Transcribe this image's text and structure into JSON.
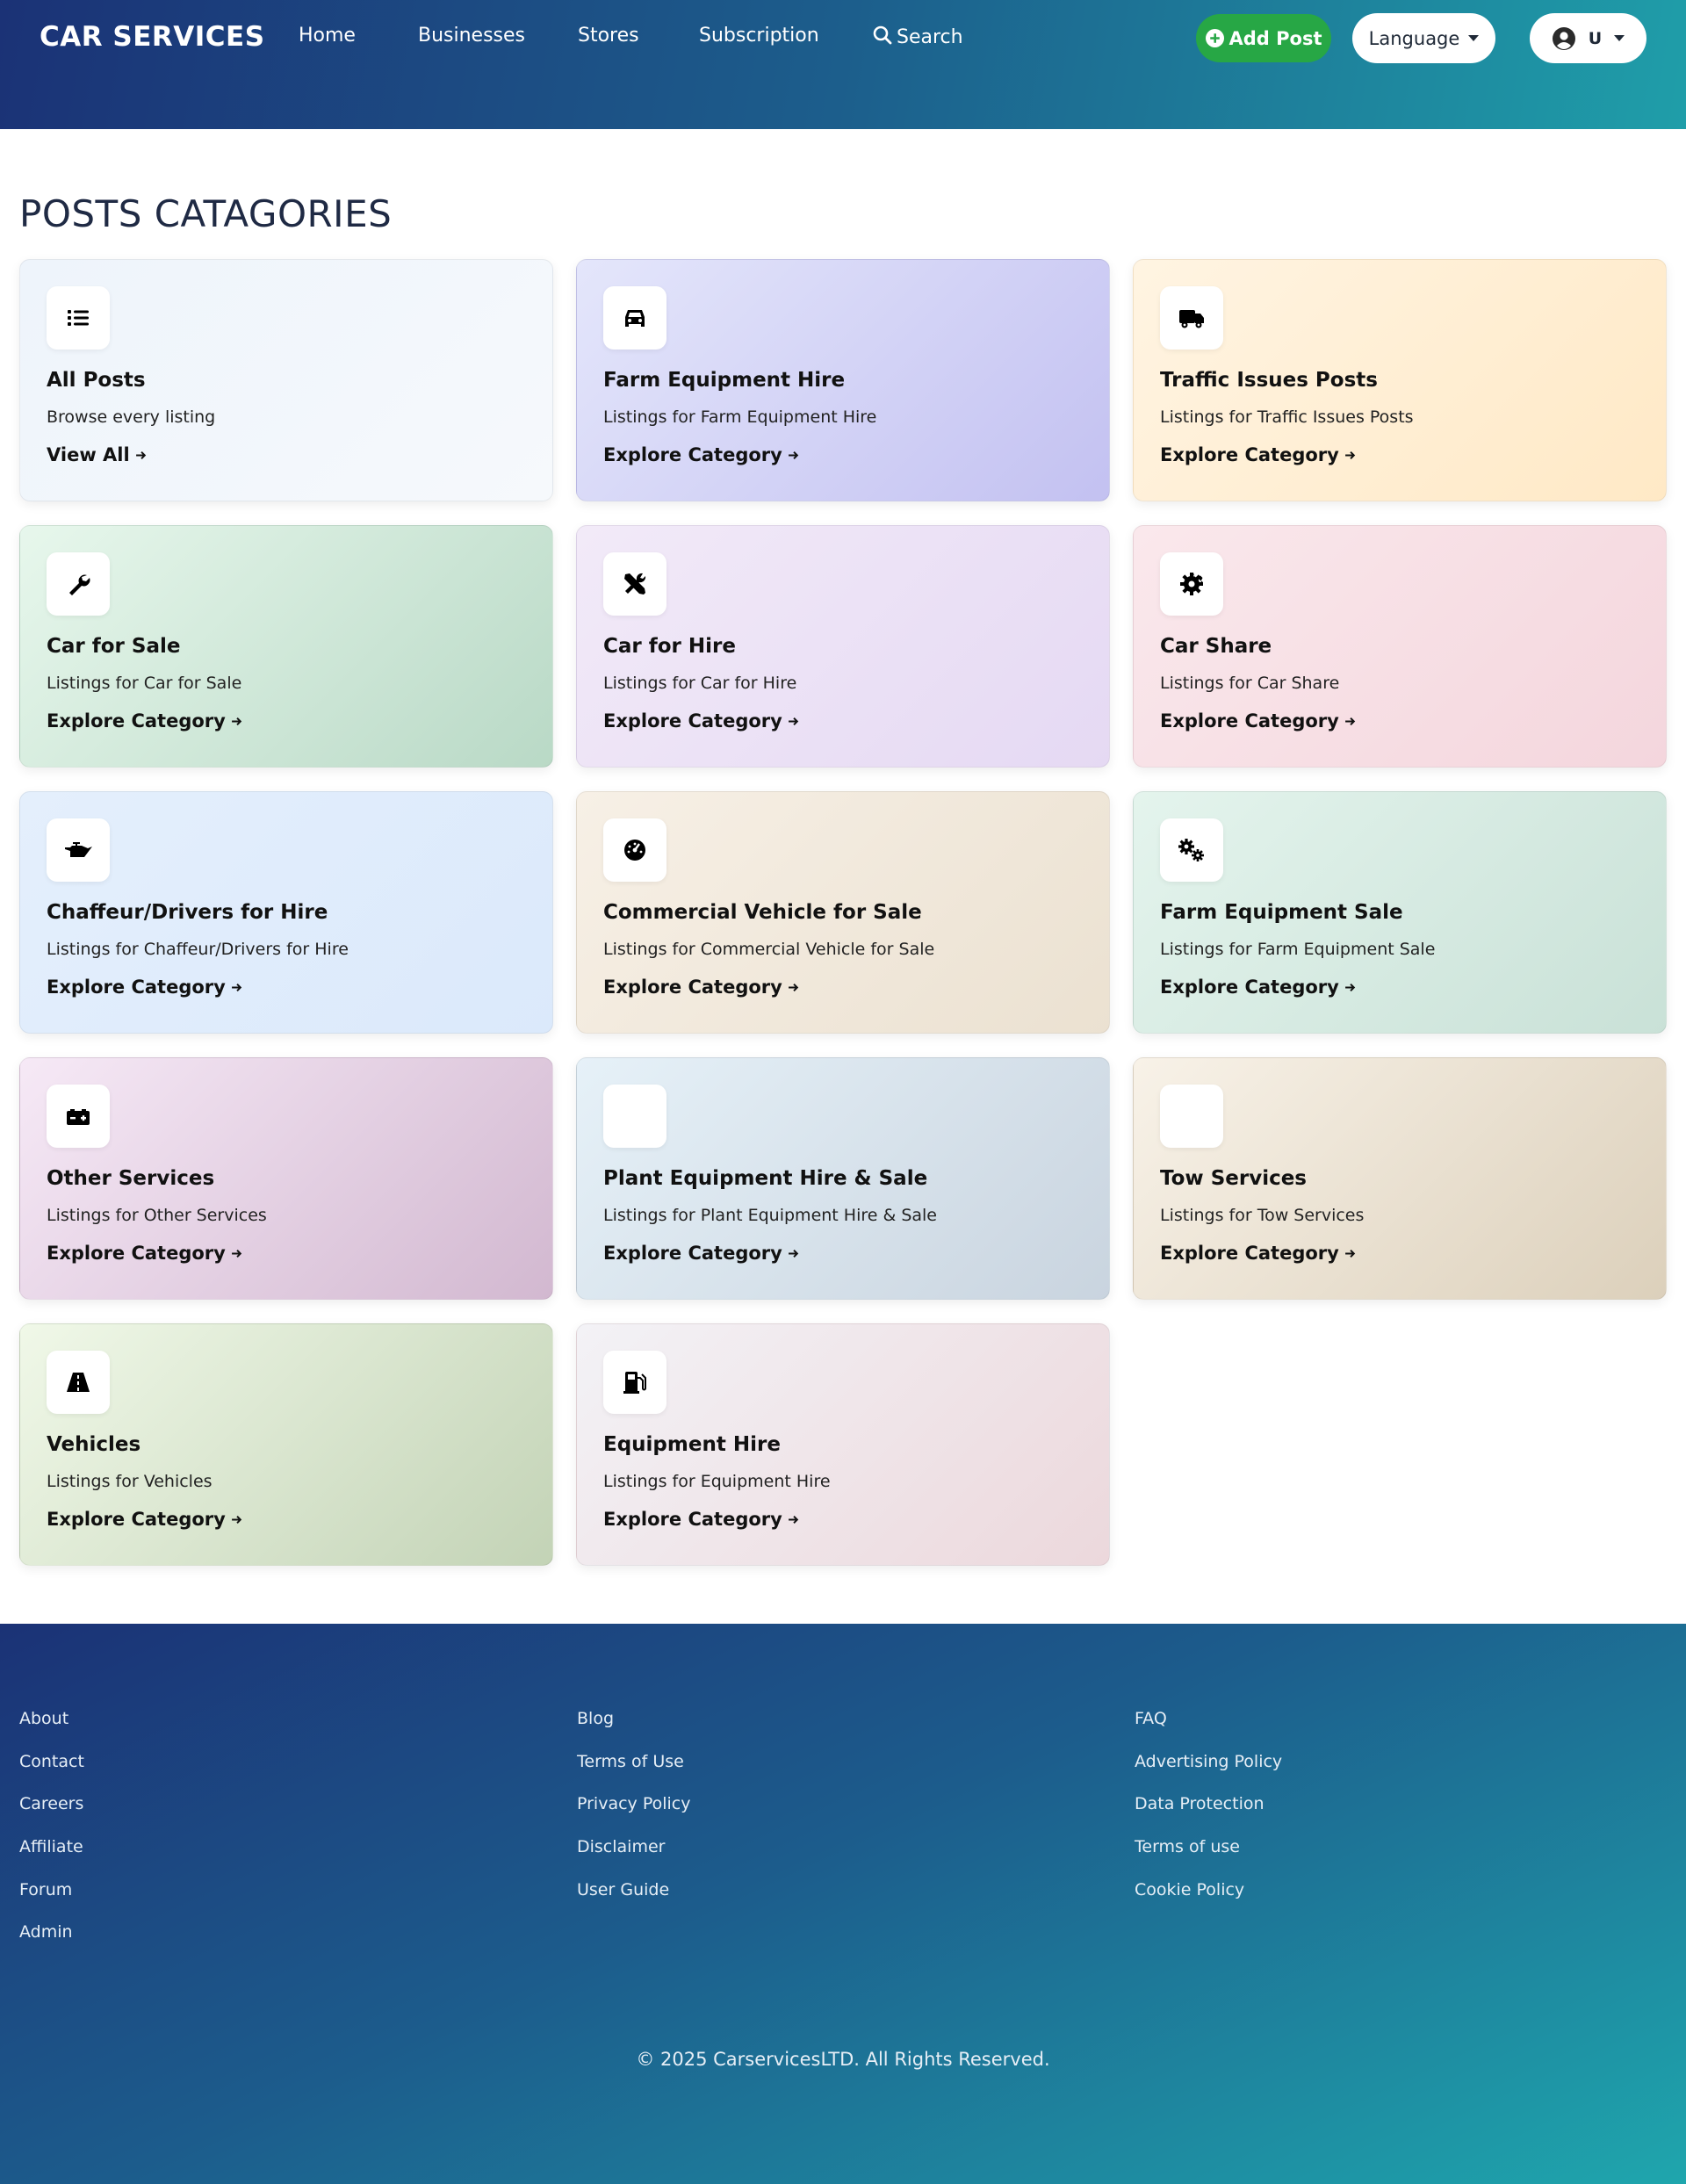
{
  "header": {
    "brand": "CAR SERVICES",
    "nav": {
      "home": "Home",
      "businesses": "Businesses",
      "stores": "Stores",
      "subscription": "Subscription",
      "search": "Search"
    },
    "add_post": "Add Post",
    "language": "Language",
    "user_initial": "U"
  },
  "main": {
    "title": "POSTS CATAGORIES",
    "cards": [
      {
        "title": "All Posts",
        "desc": "Browse every listing",
        "link": "View All",
        "icon": "list-icon"
      },
      {
        "title": "Farm Equipment Hire",
        "desc": "Listings for Farm Equipment Hire",
        "link": "Explore Category",
        "icon": "car-icon"
      },
      {
        "title": "Traffic Issues Posts",
        "desc": "Listings for Traffic Issues Posts",
        "link": "Explore Category",
        "icon": "truck-icon"
      },
      {
        "title": "Car for Sale",
        "desc": "Listings for Car for Sale",
        "link": "Explore Category",
        "icon": "wrench-icon"
      },
      {
        "title": "Car for Hire",
        "desc": "Listings for Car for Hire",
        "link": "Explore Category",
        "icon": "screwdriver-wrench-icon"
      },
      {
        "title": "Car Share",
        "desc": "Listings for Car Share",
        "link": "Explore Category",
        "icon": "gear-icon"
      },
      {
        "title": "Chaffeur/Drivers for Hire",
        "desc": "Listings for Chaffeur/Drivers for Hire",
        "link": "Explore Category",
        "icon": "oil-can-icon"
      },
      {
        "title": "Commercial Vehicle for Sale",
        "desc": "Listings for Commercial Vehicle for Sale",
        "link": "Explore Category",
        "icon": "gauge-icon"
      },
      {
        "title": "Farm Equipment Sale",
        "desc": "Listings for Farm Equipment Sale",
        "link": "Explore Category",
        "icon": "gears-icon"
      },
      {
        "title": "Other Services",
        "desc": "Listings for Other Services",
        "link": "Explore Category",
        "icon": "car-battery-icon"
      },
      {
        "title": "Plant Equipment Hire & Sale",
        "desc": "Listings for Plant Equipment Hire & Sale",
        "link": "Explore Category",
        "icon": ""
      },
      {
        "title": "Tow Services",
        "desc": "Listings for Tow Services",
        "link": "Explore Category",
        "icon": ""
      },
      {
        "title": "Vehicles",
        "desc": "Listings for Vehicles",
        "link": "Explore Category",
        "icon": "road-icon"
      },
      {
        "title": "Equipment Hire",
        "desc": "Listings for Equipment Hire",
        "link": "Explore Category",
        "icon": "gas-pump-icon"
      }
    ]
  },
  "footer": {
    "col1": [
      "About",
      "Contact",
      "Careers",
      "Affiliate",
      "Forum",
      "Admin"
    ],
    "col2": [
      "Blog",
      "Terms of Use",
      "Privacy Policy",
      "Disclaimer",
      "User Guide"
    ],
    "col3": [
      "FAQ",
      "Advertising Policy",
      "Data Protection",
      "Terms of use",
      "Cookie Policy"
    ],
    "copyright": "© 2025 CarservicesLTD. All Rights Reserved."
  },
  "colors": {
    "header_gradient": [
      "#1b3276",
      "#1f9ea9"
    ],
    "add_post_green": "#27a745",
    "card_backgrounds": [
      [
        "#eef4fb",
        "#f6f9fc"
      ],
      [
        "#e4e6fb",
        "#c3c1f1"
      ],
      [
        "#fff4e2",
        "#ffe9c6"
      ],
      [
        "#e7f7ec",
        "#b9d9c6"
      ],
      [
        "#f2eaf8",
        "#e5d9f3"
      ],
      [
        "#fae8ec",
        "#f4d6dd"
      ],
      [
        "#e4effc",
        "#dbe9fb"
      ],
      [
        "#f7f0e6",
        "#ebe1d1"
      ],
      [
        "#e4f4ed",
        "#c9e1d7"
      ],
      [
        "#f6e9f6",
        "#d2b8d0"
      ],
      [
        "#e6f1f8",
        "#c9d4df"
      ],
      [
        "#f8f2e8",
        "#dcd0bb"
      ],
      [
        "#f0f8e8",
        "#c3d3b6"
      ],
      [
        "#f3f2f6",
        "#ecd8dc"
      ]
    ]
  }
}
